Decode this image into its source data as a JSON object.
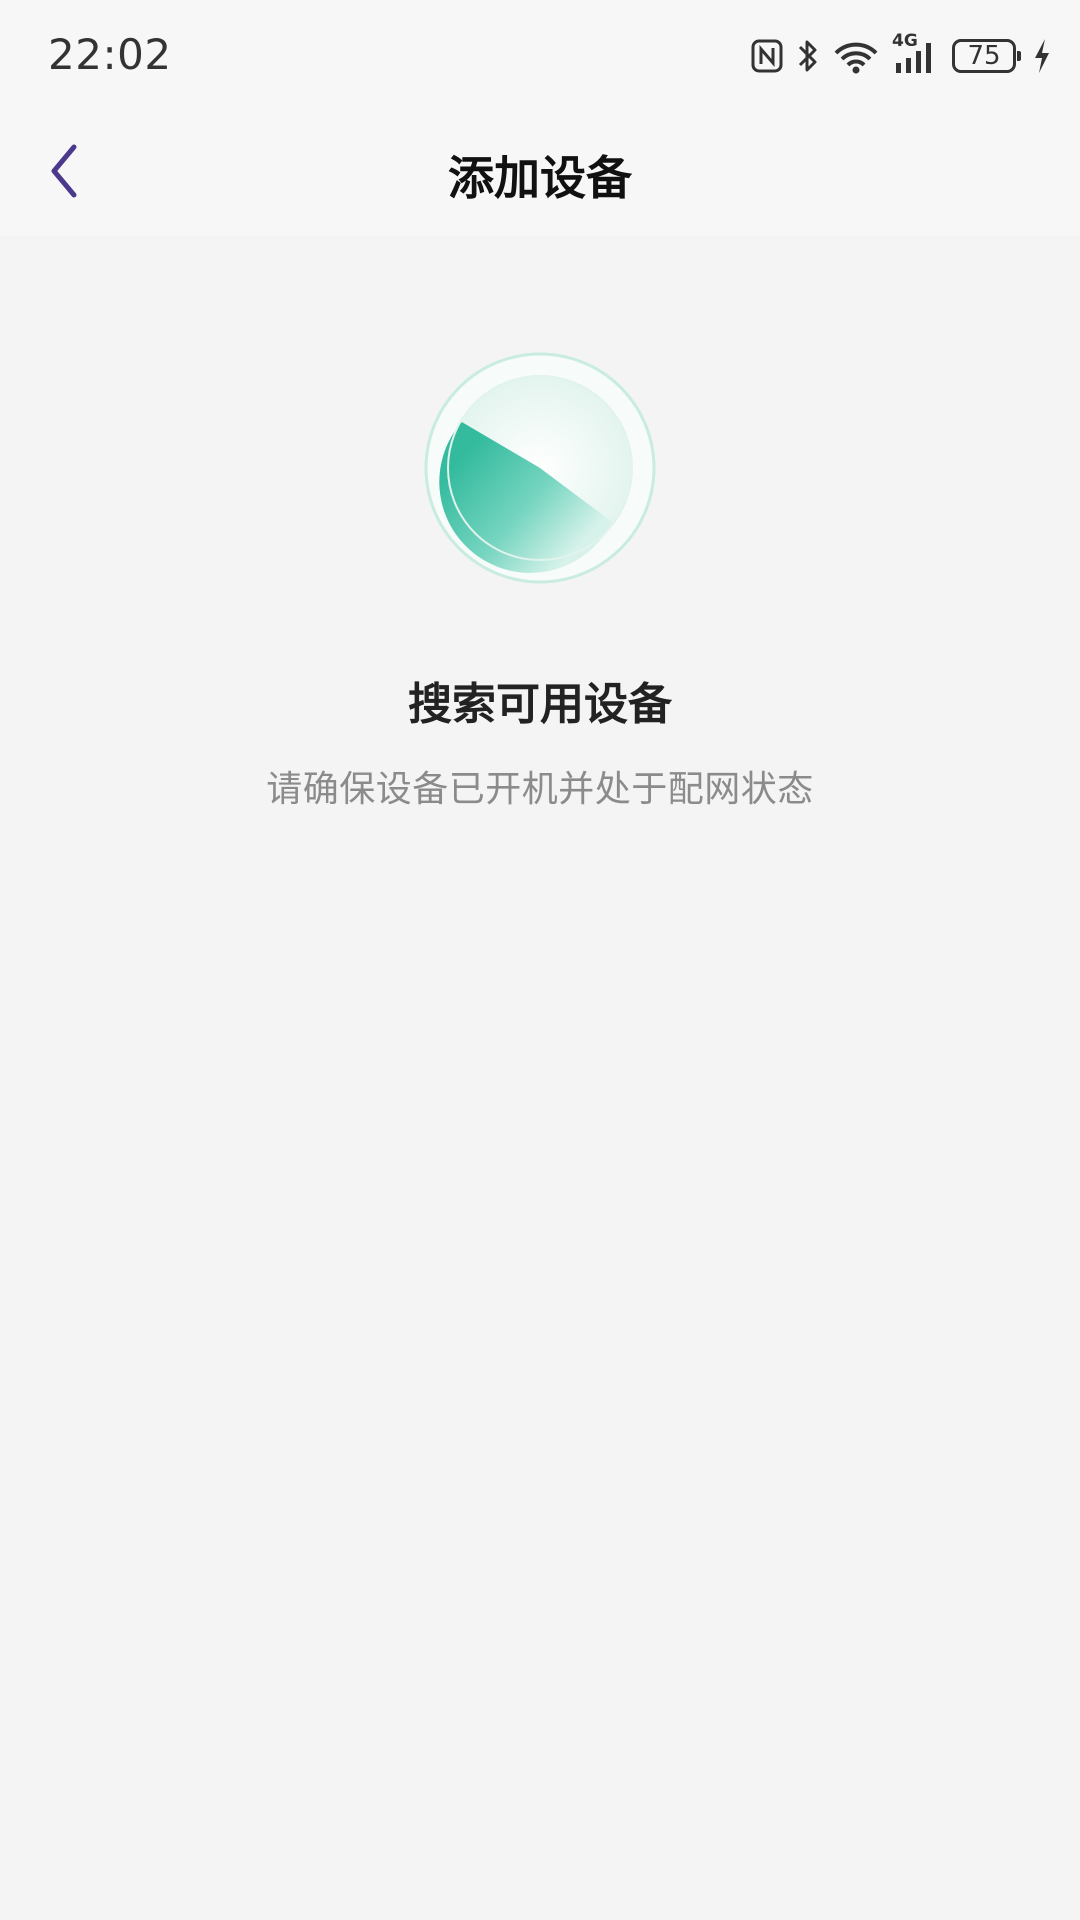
{
  "status_bar": {
    "time": "22:02",
    "battery_level": "75",
    "network": "4G",
    "icons": [
      "nfc-icon",
      "bluetooth-icon",
      "wifi-icon",
      "cellular-signal-icon",
      "battery-icon",
      "charging-icon"
    ]
  },
  "navbar": {
    "back_icon": "chevron-left-icon",
    "title": "添加设备"
  },
  "search": {
    "title": "搜索可用设备",
    "hint": "请确保设备已开机并处于配网状态"
  },
  "colors": {
    "accent": "#2bb89a",
    "back_icon": "#4b3a8c",
    "background": "#f4f4f5"
  }
}
